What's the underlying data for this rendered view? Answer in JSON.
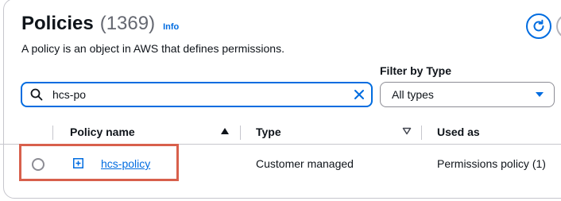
{
  "header": {
    "title": "Policies",
    "count": "(1369)",
    "info_label": "Info",
    "description": "A policy is an object in AWS that defines permissions."
  },
  "filter": {
    "label": "Filter by Type",
    "selected": "All types"
  },
  "search": {
    "value": "hcs-po"
  },
  "table": {
    "columns": [
      "Policy name",
      "Type",
      "Used as"
    ],
    "rows": [
      {
        "name": "hcs-policy",
        "type": "Customer managed",
        "used_as": "Permissions policy (1)"
      }
    ]
  },
  "colors": {
    "accent": "#006ce0",
    "highlight": "#d8604c"
  },
  "icons": {
    "refresh": "refresh-icon",
    "search": "search-icon",
    "clear": "close-icon",
    "dropdown": "caret-down-icon",
    "sort_asc": "sort-ascending-icon",
    "sort_none": "sort-icon",
    "expand": "plus-square-icon"
  }
}
